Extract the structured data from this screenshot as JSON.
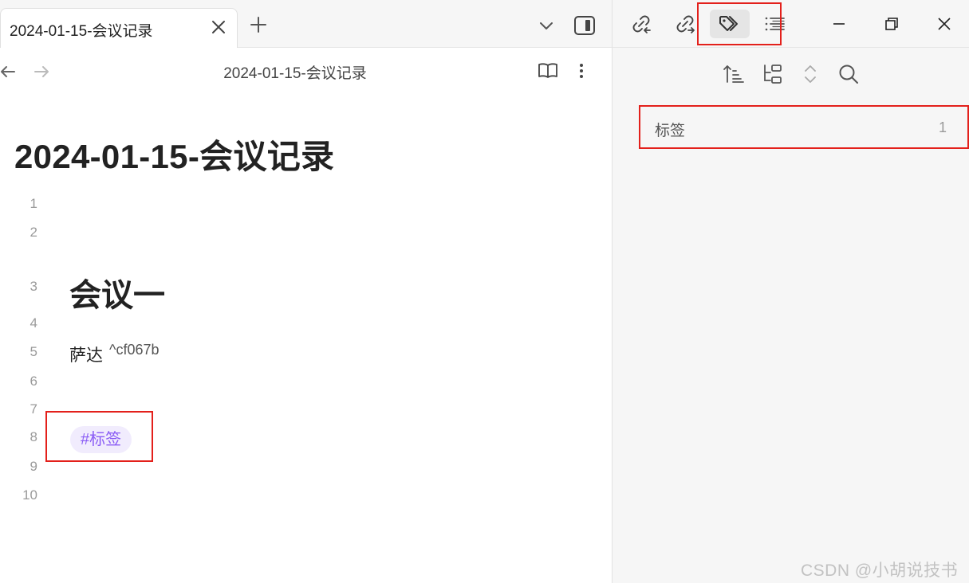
{
  "tab": {
    "title": "2024-01-15-会议记录"
  },
  "header": {
    "view_title": "2024-01-15-会议记录"
  },
  "note": {
    "title": "2024-01-15-会议记录",
    "line_numbers": [
      "1",
      "2",
      "3",
      "4",
      "5",
      "6",
      "7",
      "8",
      "9",
      "10"
    ],
    "heading": "会议一",
    "text": "萨达",
    "block_id": "^cf067b",
    "tag": "#标签"
  },
  "tags_panel": {
    "items": [
      {
        "name": "标签",
        "count": "1"
      }
    ]
  },
  "icons": {
    "tab_close": "close-icon",
    "new_tab": "plus-icon",
    "tab_list": "chevron-down-icon",
    "toggle_sidebar": "sidebar-toggle-icon",
    "back": "arrow-left-icon",
    "forward": "arrow-right-icon",
    "reading_view": "book-open-icon",
    "more": "more-vertical-icon",
    "backlinks": "link-in-icon",
    "outgoing_links": "link-out-icon",
    "tags": "tags-icon",
    "outline": "list-icon",
    "minimize": "minimize-icon",
    "restore": "restore-icon",
    "close_window": "close-icon",
    "sort": "sort-icon",
    "nested": "nested-tags-icon",
    "collapse": "expand-collapse-icon",
    "search": "search-icon"
  },
  "colors": {
    "highlight": "#e3201b",
    "tag_text": "#8a5cf5",
    "tag_bg": "#f1ecfd",
    "sidebar_bg": "#f6f6f6"
  },
  "watermark": "CSDN @小胡说技书"
}
